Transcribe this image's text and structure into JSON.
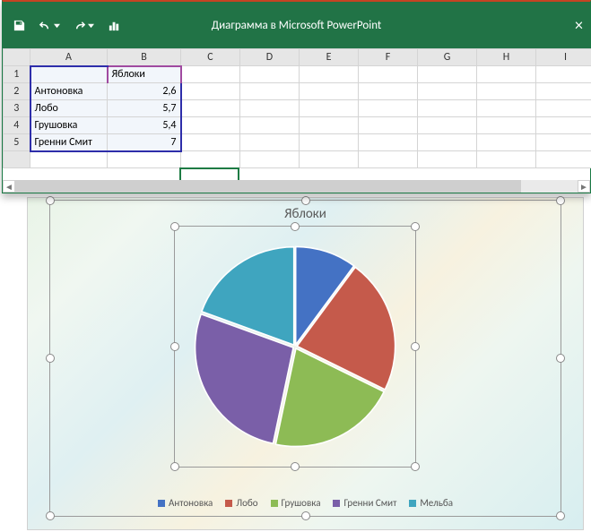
{
  "window": {
    "title": "Диаграмма в Microsoft PowerPoint"
  },
  "sheet": {
    "columns": [
      "A",
      "B",
      "C",
      "D",
      "E",
      "F",
      "G",
      "H",
      "I"
    ],
    "header_b1": "Яблоки",
    "rows": [
      {
        "n": "2",
        "a": "Антоновка",
        "b": "2,6"
      },
      {
        "n": "3",
        "a": "Лобо",
        "b": "5,7"
      },
      {
        "n": "4",
        "a": "Грушовка",
        "b": "5,4"
      },
      {
        "n": "5",
        "a": "Гренни Смит",
        "b": "7"
      }
    ]
  },
  "chart_data": {
    "type": "pie",
    "title": "Яблоки",
    "categories": [
      "Антоновка",
      "Лобо",
      "Грушовка",
      "Гренни Смит",
      "Мельба"
    ],
    "values": [
      2.6,
      5.7,
      5.4,
      7,
      5
    ],
    "colors": [
      "#4472c4",
      "#c55a4b",
      "#8dbb55",
      "#7a5fa8",
      "#3fa5bf"
    ]
  },
  "legend": {
    "items": [
      {
        "label": "Антоновка",
        "color": "#4472c4"
      },
      {
        "label": "Лобо",
        "color": "#c55a4b"
      },
      {
        "label": "Грушовка",
        "color": "#8dbb55"
      },
      {
        "label": "Гренни Смит",
        "color": "#7a5fa8"
      },
      {
        "label": "Мельба",
        "color": "#3fa5bf"
      }
    ]
  }
}
